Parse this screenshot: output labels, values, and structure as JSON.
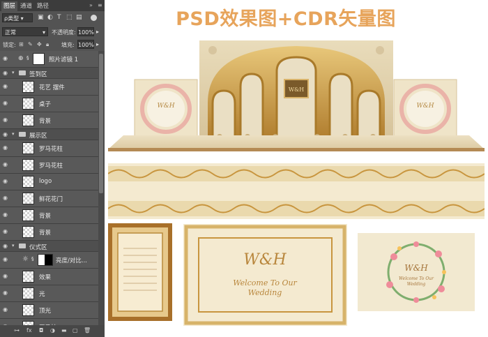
{
  "title": "PSD效果图+CDR矢量图",
  "panel": {
    "tabs": [
      "图层",
      "通道",
      "路径"
    ],
    "kind_label": "ρ类型",
    "blend_mode": "正常",
    "opacity_label": "不透明度:",
    "opacity_value": "100%",
    "lock_label": "锁定:",
    "fill_label": "填充:",
    "fill_value": "100%",
    "layers": [
      {
        "type": "adjustment",
        "name": "照片滤镜 1"
      },
      {
        "type": "group",
        "name": "签到区"
      },
      {
        "type": "layer",
        "name": "花艺 摆件"
      },
      {
        "type": "layer",
        "name": "桌子"
      },
      {
        "type": "layer",
        "name": "背景"
      },
      {
        "type": "group",
        "name": "展示区"
      },
      {
        "type": "layer",
        "name": "罗马花柱"
      },
      {
        "type": "layer",
        "name": "罗马花柱"
      },
      {
        "type": "layer",
        "name": "logo"
      },
      {
        "type": "layer",
        "name": "鲜花花门"
      },
      {
        "type": "layer",
        "name": "背景"
      },
      {
        "type": "layer",
        "name": "背景"
      },
      {
        "type": "group",
        "name": "仪式区"
      },
      {
        "type": "adjustment",
        "name": "亮度/对比..."
      },
      {
        "type": "layer",
        "name": "效果"
      },
      {
        "type": "layer",
        "name": "光"
      },
      {
        "type": "layer",
        "name": "顶光"
      },
      {
        "type": "layer",
        "name": "罗马柱"
      }
    ]
  },
  "stage": {
    "logo_monogram": "W&H",
    "sign_text": "Welcome To Our Wedding"
  },
  "cards": {
    "monogram": "W&H",
    "welcome_line1": "Welcome To Our",
    "welcome_line2": "Wedding",
    "right_monogram": "W&H",
    "right_line1": "Welcome To Our",
    "right_line2": "Wedding"
  },
  "colors": {
    "title": "#e7a45b",
    "gold": "#c8953e",
    "cream": "#f4ead0",
    "panel_bg": "#535353"
  }
}
